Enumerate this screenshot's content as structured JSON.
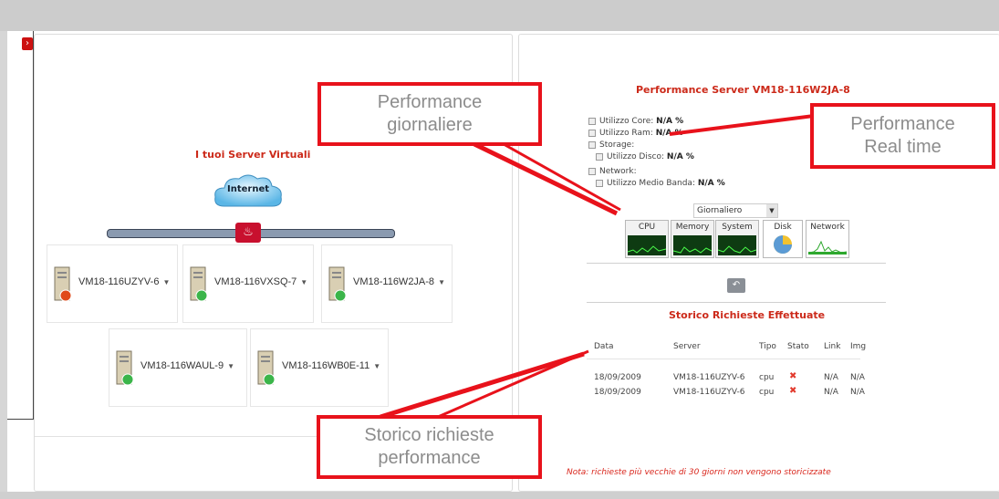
{
  "left_panel": {
    "title": "I tuoi Server Virtuali",
    "cloud_label": "Internet",
    "toggle_glyph": "›",
    "servers": [
      {
        "name": "VM18-116UZYV-6",
        "status": "red"
      },
      {
        "name": "VM18-116VXSQ-7",
        "status": "green"
      },
      {
        "name": "VM18-116W2JA-8",
        "status": "green"
      },
      {
        "name": "VM18-116WAUL-9",
        "status": "green"
      },
      {
        "name": "VM18-116WB0E-11",
        "status": "green"
      }
    ]
  },
  "right_panel": {
    "title": "Performance Server VM18-116W2JA-8",
    "stats": {
      "core_label": "Utilizzo Core:",
      "core_value": "N/A %",
      "ram_label": "Utilizzo Ram:",
      "ram_value": "N/A %",
      "storage_label": "Storage:",
      "disk_label": "Utilizzo Disco:",
      "disk_value": "N/A %",
      "network_label": "Network:",
      "band_label": "Utilizzo Medio Banda:",
      "band_value": "N/A %"
    },
    "period_select": "Giornaliero",
    "tabs": [
      {
        "label": "CPU"
      },
      {
        "label": "Memory"
      },
      {
        "label": "System"
      },
      {
        "label": "Disk"
      },
      {
        "label": "Network"
      }
    ],
    "history_title": "Storico Richieste Effettuate",
    "history": {
      "columns": [
        "Data",
        "Server",
        "Tipo",
        "Stato",
        "Link",
        "Img"
      ],
      "rows": [
        {
          "date": "18/09/2009",
          "server": "VM18-116UZYV-6",
          "type": "cpu",
          "link": "N/A",
          "img": "N/A"
        },
        {
          "date": "18/09/2009",
          "server": "VM18-116UZYV-6",
          "type": "cpu",
          "link": "N/A",
          "img": "N/A"
        }
      ]
    },
    "note": "Nota: richieste più vecchie di 30 giorni non vengono storicizzate"
  },
  "callouts": {
    "daily_line1": "Performance",
    "daily_line2": "giornaliere",
    "realtime_line1": "Performance",
    "realtime_line2": "Real time",
    "history_line1": "Storico richieste",
    "history_line2": "performance"
  },
  "colors": {
    "accent_red": "#e8121b",
    "title_red": "#cc2a1a",
    "status_green": "#3bb54a",
    "status_red": "#e04a1a"
  }
}
